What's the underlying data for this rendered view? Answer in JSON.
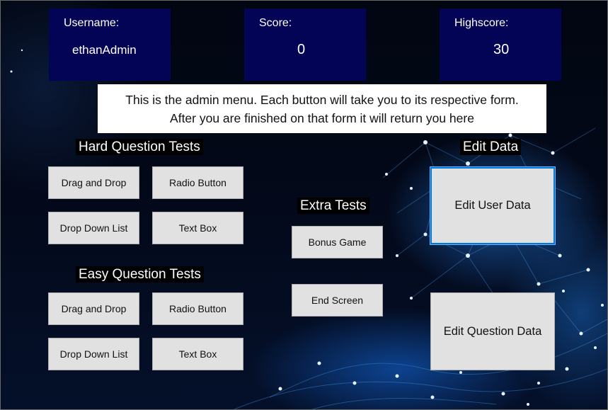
{
  "stats": {
    "username": {
      "label": "Username:",
      "value": "ethanAdmin"
    },
    "score": {
      "label": "Score:",
      "value": "0"
    },
    "highscore": {
      "label": "Highscore:",
      "value": "30"
    }
  },
  "notice": {
    "line1": "This is the admin menu. Each button will take you to its respective form.",
    "line2": "After you are finished on that form it will return you here"
  },
  "hard_tests": {
    "title": "Hard Question Tests",
    "drag_drop": "Drag and Drop",
    "radio": "Radio Button",
    "dropdown": "Drop Down List",
    "textbox": "Text Box"
  },
  "easy_tests": {
    "title": "Easy Question Tests",
    "drag_drop": "Drag and Drop",
    "radio": "Radio Button",
    "dropdown": "Drop Down List",
    "textbox": "Text Box"
  },
  "extra_tests": {
    "title": "Extra Tests",
    "bonus": "Bonus Game",
    "end": "End Screen"
  },
  "edit_data": {
    "title": "Edit Data",
    "user": "Edit User Data",
    "question": "Edit Question Data"
  },
  "colors": {
    "panel": "#030455",
    "button": "#e1e1e1",
    "focus": "#0078d7"
  }
}
